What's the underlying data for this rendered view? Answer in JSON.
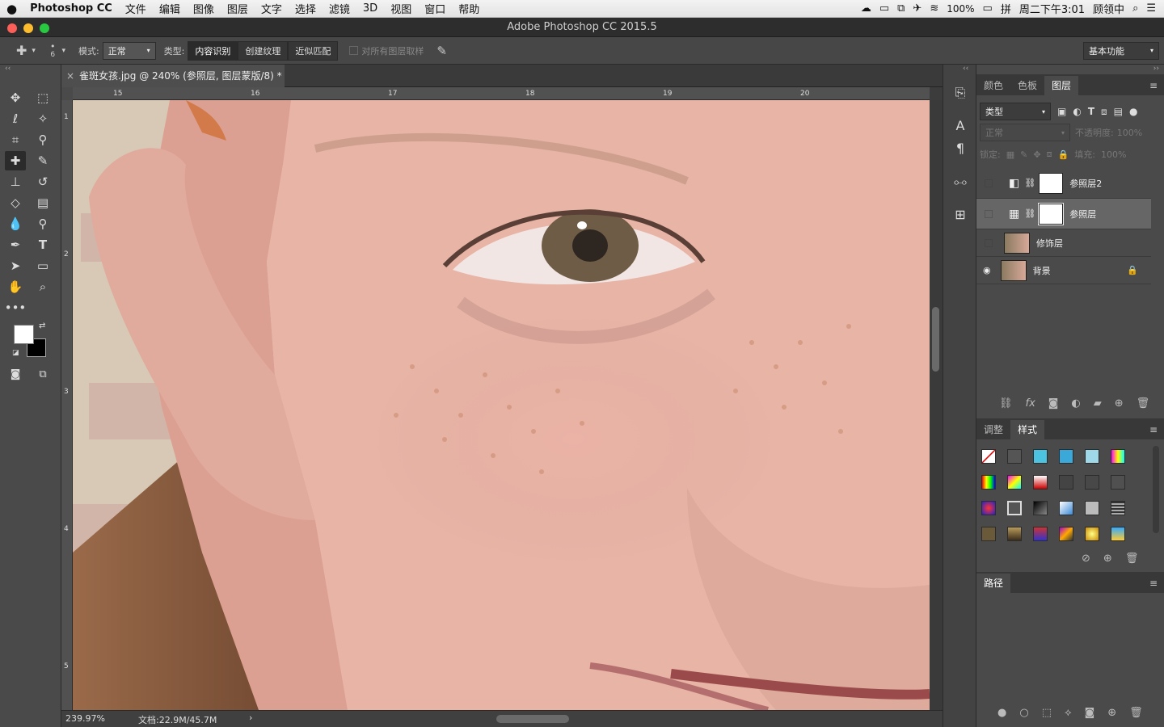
{
  "menubar": {
    "apple": "",
    "app": "Photoshop CC",
    "items": [
      "文件",
      "编辑",
      "图像",
      "图层",
      "文字",
      "选择",
      "滤镜",
      "3D",
      "视图",
      "窗口",
      "帮助"
    ],
    "battery": "100%",
    "datetime": "周二下午3:01",
    "user": "顾领中"
  },
  "window": {
    "title": "Adobe Photoshop CC 2015.5"
  },
  "options": {
    "brush_size": "6",
    "mode_label": "模式:",
    "mode_value": "正常",
    "type_label": "类型:",
    "type_buttons": [
      "内容识别",
      "创建纹理",
      "近似匹配"
    ],
    "sample_all": "对所有图层取样",
    "workspace": "基本功能"
  },
  "document": {
    "tab_title": "雀斑女孩.jpg @ 240% (参照层, 图层蒙版/8) *",
    "ruler_h": [
      "15",
      "16",
      "17",
      "18",
      "19",
      "20"
    ],
    "ruler_v": [
      "1",
      "2",
      "3",
      "4",
      "5"
    ]
  },
  "status": {
    "zoom": "239.97%",
    "doc_size": "文档:22.9M/45.7M",
    "arrow": "›"
  },
  "layers_panel": {
    "tabs": [
      "颜色",
      "色板",
      "图层"
    ],
    "active_tab": "图层",
    "filter_kind": "类型",
    "blend": "正常",
    "opacity_label": "不透明度:",
    "opacity_value": "100%",
    "lock_label": "锁定:",
    "fill_label": "填充:",
    "fill_value": "100%",
    "layers": [
      {
        "name": "参照层2",
        "visible": false,
        "selected": false,
        "kind": "adjustment"
      },
      {
        "name": "参照层",
        "visible": false,
        "selected": true,
        "kind": "adjustment"
      },
      {
        "name": "修饰层",
        "visible": false,
        "selected": false,
        "kind": "image"
      },
      {
        "name": "背景",
        "visible": true,
        "selected": false,
        "kind": "image",
        "locked": true
      }
    ]
  },
  "styles_panel": {
    "tabs": [
      "调整",
      "样式"
    ],
    "active_tab": "样式"
  },
  "paths_panel": {
    "title": "路径"
  },
  "colors": {
    "foreground": "#ffffff",
    "background": "#000000",
    "accent": "#4a4a4a"
  }
}
